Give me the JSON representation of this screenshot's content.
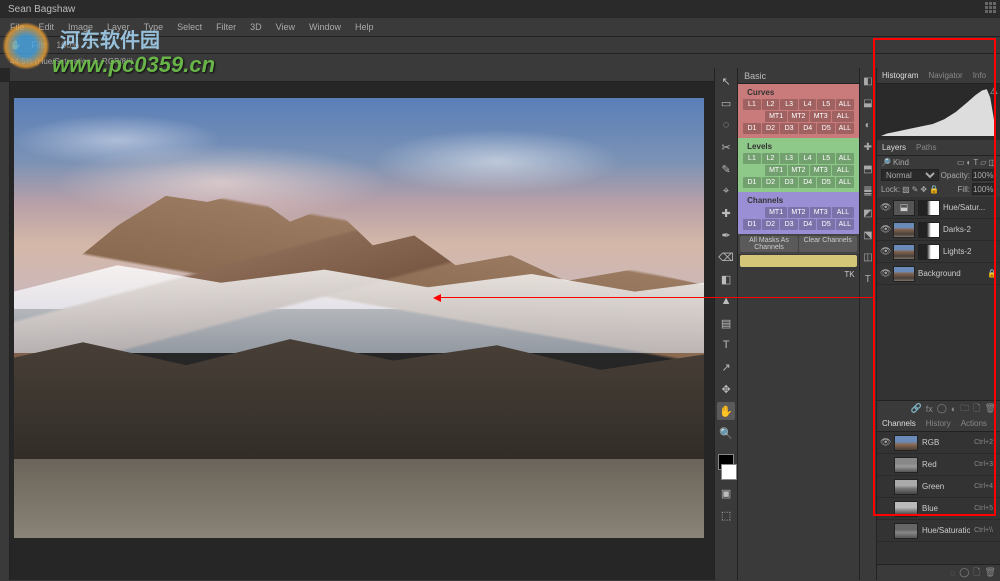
{
  "title": "Sean Bagshaw",
  "menu": [
    "File",
    "Edit",
    "Image",
    "Layer",
    "Type",
    "Select",
    "Filter",
    "3D",
    "View",
    "Window",
    "Help"
  ],
  "options": {
    "fit": "Filtr",
    "zoom": "100%"
  },
  "doc_tab": "44.5% (Hue/Saturation 1, RGB/8#)",
  "watermark": {
    "url": "www.pc0359.cn",
    "chars": "河东软件园"
  },
  "tools": [
    "↖",
    "▭",
    "◌",
    "✂",
    "✎",
    "⌖",
    "✚",
    "✒",
    "⌫",
    "◧",
    "▲",
    "▤",
    "T",
    "↗",
    "✥",
    "◯",
    "🔍",
    "✋"
  ],
  "tk": {
    "tab": "Basic",
    "curves": {
      "label": "Curves",
      "r1": [
        "L1",
        "L2",
        "L3",
        "L4",
        "L5",
        "ALL"
      ],
      "r2": [
        "",
        "MT1",
        "MT2",
        "MT3",
        "ALL"
      ],
      "r3": [
        "D1",
        "D2",
        "D3",
        "D4",
        "D5",
        "ALL"
      ]
    },
    "levels": {
      "label": "Levels",
      "r1": [
        "L1",
        "L2",
        "L3",
        "L4",
        "L5",
        "ALL"
      ],
      "r2": [
        "",
        "MT1",
        "MT2",
        "MT3",
        "ALL"
      ],
      "r3": [
        "D1",
        "D2",
        "D3",
        "D4",
        "D5",
        "ALL"
      ]
    },
    "channels": {
      "label": "Channels",
      "r2": [
        "",
        "MT1",
        "MT2",
        "MT3",
        "ALL"
      ],
      "r3": [
        "D1",
        "D2",
        "D3",
        "D4",
        "D5",
        "ALL"
      ]
    },
    "actions": [
      "All Masks As Channels",
      "Clear Channels"
    ],
    "tk_label": "TK"
  },
  "panels": {
    "top_tabs": [
      "Histogram",
      "Navigator",
      "Info"
    ],
    "layers_tabs": [
      "Layers",
      "Paths"
    ],
    "kind_label": "Kind",
    "blend": "Normal",
    "opacity_label": "Opacity:",
    "opacity": "100%",
    "lock_label": "Lock:",
    "fill_label": "Fill:",
    "fill": "100%",
    "layers": [
      {
        "name": "Hue/Satur...",
        "icon": true
      },
      {
        "name": "Darks-2"
      },
      {
        "name": "Lights-2"
      },
      {
        "name": "Background",
        "bg": true
      }
    ],
    "channels_tabs": [
      "Channels",
      "History",
      "Actions"
    ],
    "channels": [
      {
        "name": "RGB",
        "sc": "Ctrl+2",
        "cls": "ch-rgb",
        "eye": true
      },
      {
        "name": "Red",
        "sc": "Ctrl+3",
        "cls": "ch-r"
      },
      {
        "name": "Green",
        "sc": "Ctrl+4",
        "cls": "ch-g"
      },
      {
        "name": "Blue",
        "sc": "Ctrl+5",
        "cls": "ch-b"
      },
      {
        "name": "Hue/Saturation...",
        "sc": "Ctrl+\\\\",
        "cls": "ch-hs"
      }
    ]
  },
  "icons": [
    "◧",
    "⬓",
    "◐",
    "✚",
    "⬒",
    "䷀",
    "◩",
    "⬔",
    "◫",
    "T",
    "◑",
    "⬕"
  ]
}
